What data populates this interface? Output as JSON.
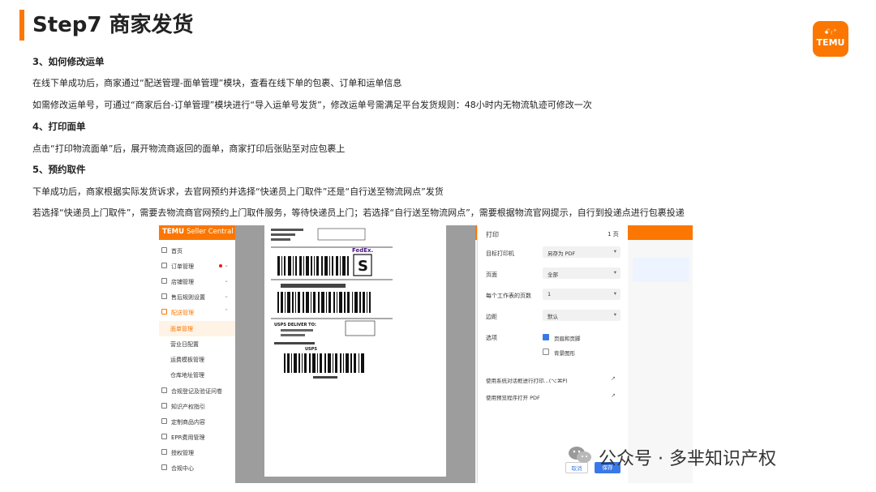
{
  "slide": {
    "title": "Step7 商家发货",
    "logo": {
      "top": "ꗃ₍ᐢ",
      "word": "TEMU"
    },
    "sections": [
      {
        "heading": "3、如何修改运单",
        "lines": [
          "在线下单成功后，商家通过“配送管理-面单管理”模块，查看在线下单的包裹、订单和运单信息",
          "如需修改运单号，可通过“商家后台-订单管理”模块进行“导入运单号发货”，修改运单号需满足平台发货规则：48小时内无物流轨迹可修改一次"
        ]
      },
      {
        "heading": "4、打印面单",
        "lines": [
          "点击“打印物流面单”后，展开物流商返回的面单，商家打印后张贴至对应包裹上"
        ]
      },
      {
        "heading": "5、预约取件",
        "lines": [
          "下单成功后，商家根据实际发货诉求，去官网预约并选择“快递员上门取件”还是“自行送至物流网点”发货",
          "若选择“快递员上门取件”，需要去物流商官网预约上门取件服务，等待快递员上门；若选择“自行送至物流网点”，需要根据物流官网提示，自行到投递点进行包裹投递"
        ]
      }
    ]
  },
  "screenshot": {
    "brand": "TEMU",
    "brand_sub": "Seller Central",
    "sidebar": [
      {
        "label": "首页"
      },
      {
        "label": "订单管理"
      },
      {
        "label": "店铺管理"
      },
      {
        "label": "售后规则设置"
      },
      {
        "label": "配送管理"
      },
      {
        "label": "面单管理"
      },
      {
        "label": "营业日配置"
      },
      {
        "label": "运费模板管理"
      },
      {
        "label": "仓库地址管理"
      },
      {
        "label": "合规登记及验证问卷"
      },
      {
        "label": "知识产权指引"
      },
      {
        "label": "定制商品内容"
      },
      {
        "label": "EPR费用管理"
      },
      {
        "label": "授权管理"
      },
      {
        "label": "合规中心"
      }
    ],
    "label": {
      "carrier": "FedEx.",
      "big_letter": "S",
      "usps_line1": "USPS DELIVER TO:",
      "usps_line2": "USPS"
    },
    "print_dialog": {
      "title": "打印",
      "pages_count": "1 页",
      "rows": [
        {
          "label": "目标打印机",
          "value": "另存为 PDF"
        },
        {
          "label": "页面",
          "value": "全部"
        },
        {
          "label": "每个工作表的页数",
          "value": "1"
        },
        {
          "label": "边距",
          "value": "默认"
        }
      ],
      "options_label": "选项",
      "opt_headers": "页眉和页脚",
      "opt_background": "背景图形",
      "link_system": "使用系统对话框进行打印...(⌥⌘P)",
      "link_preview": "使用预览程序打开 PDF",
      "cancel": "取消",
      "save": "保存"
    }
  },
  "watermark": "公众号 · 多芈知识产权",
  "colors": {
    "accent": "#fb7701",
    "blue": "#3b78e7"
  }
}
